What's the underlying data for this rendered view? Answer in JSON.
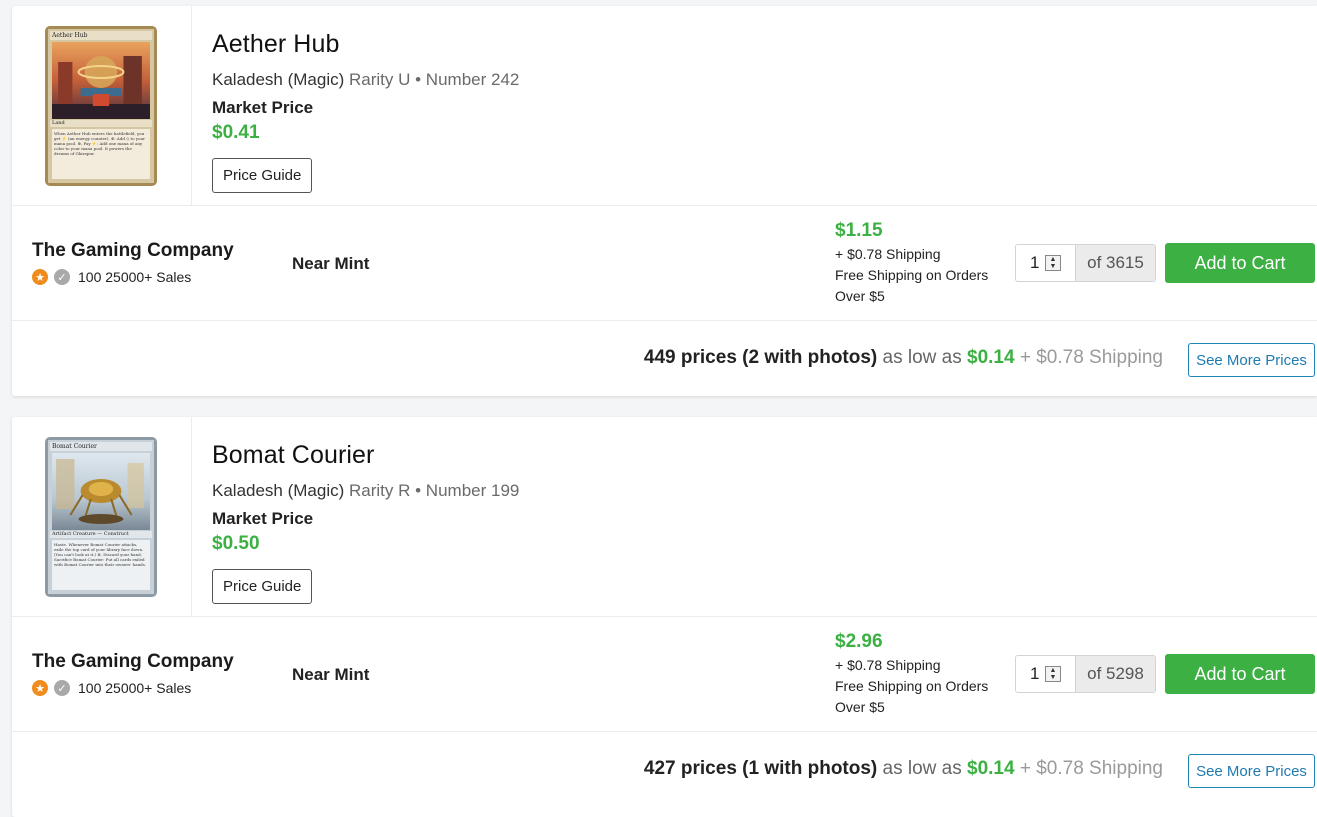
{
  "products": [
    {
      "name": "Aether Hub",
      "set": "Kaladesh (Magic)",
      "rarity_number": "Rarity U • Number 242",
      "market_price_label": "Market Price",
      "market_price": "$0.41",
      "price_guide_label": "Price Guide",
      "card_image": {
        "title": "Aether Hub",
        "type_line": "Land",
        "rules_text": "When Aether Hub enters the battlefield, you get ⚡ (an energy counter). ⊕: Add ◇ to your mana pool. ⊕, Pay ⚡: Add one mana of any color to your mana pool. It powers the dreams of Ghirapur."
      },
      "listing": {
        "seller": "The Gaming Company",
        "seller_stats": "100 25000+ Sales",
        "condition": "Near Mint",
        "price": "$1.15",
        "shipping": "+ $0.78 Shipping",
        "free_shipping": "Free Shipping on Orders Over $5",
        "quantity": "1",
        "of_available": "of 3615",
        "add_to_cart": "Add to Cart"
      },
      "more": {
        "count_text": "449 prices (2 with photos)",
        "as_low_as": "as low as",
        "low_price": "$0.14",
        "low_shipping": "+ $0.78 Shipping",
        "see_more": "See More Prices"
      }
    },
    {
      "name": "Bomat Courier",
      "set": "Kaladesh (Magic)",
      "rarity_number": "Rarity R • Number 199",
      "market_price_label": "Market Price",
      "market_price": "$0.50",
      "price_guide_label": "Price Guide",
      "card_image": {
        "title": "Bomat Courier",
        "type_line": "Artifact Creature — Construct",
        "rules_text": "Haste. Whenever Bomat Courier attacks, exile the top card of your library face down. (You can't look at it.) ⊕, Discard your hand, Sacrifice Bomat Courier: Put all cards exiled with Bomat Courier into their owners' hands."
      },
      "listing": {
        "seller": "The Gaming Company",
        "seller_stats": "100 25000+ Sales",
        "condition": "Near Mint",
        "price": "$2.96",
        "shipping": "+ $0.78 Shipping",
        "free_shipping": "Free Shipping on Orders Over $5",
        "quantity": "1",
        "of_available": "of 5298",
        "add_to_cart": "Add to Cart"
      },
      "more": {
        "count_text": "427 prices (1 with photos)",
        "as_low_as": "as low as",
        "low_price": "$0.14",
        "low_shipping": "+ $0.78 Shipping",
        "see_more": "See More Prices"
      }
    }
  ],
  "colors": {
    "price_green": "#3cb043",
    "link_blue": "#1e7bb0",
    "badge_gold": "#ef8c1d",
    "badge_gray": "#a9a9a9"
  }
}
